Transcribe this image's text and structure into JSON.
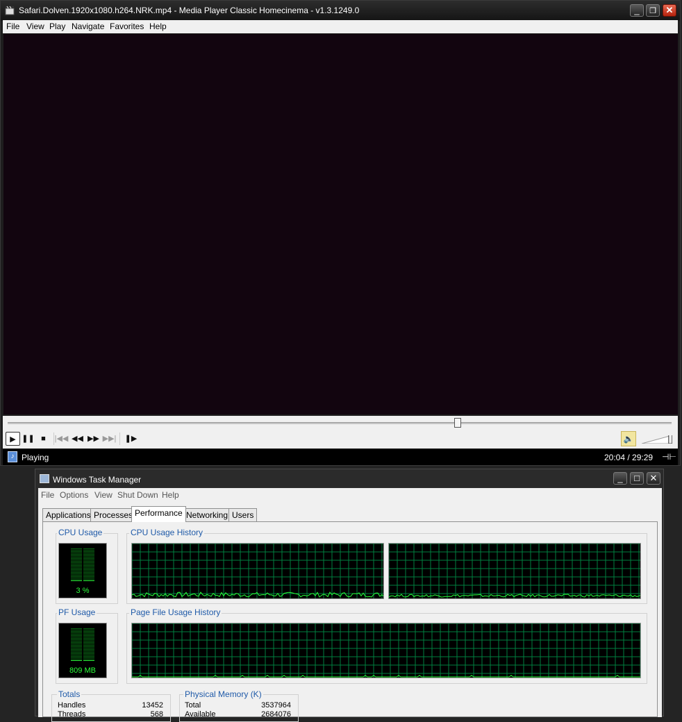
{
  "mpc": {
    "title": "Safari.Dolven.1920x1080.h264.NRK.mp4 - Media Player Classic Homecinema - v1.3.1249.0",
    "menu": [
      "File",
      "View",
      "Play",
      "Navigate",
      "Favorites",
      "Help"
    ],
    "menu_mnemonics": [
      "F",
      "V",
      "P",
      "N",
      "a",
      "H"
    ],
    "seek_position": 0.678,
    "volume_level": 0.95,
    "status": "Playing",
    "time": "20:04 / 29:29",
    "buttons": [
      "play-icon",
      "pause-icon",
      "stop-icon",
      "skip-back-icon",
      "rewind-icon",
      "fast-forward-icon",
      "skip-forward-icon",
      "frame-step-icon"
    ],
    "video_color": "#12050f"
  },
  "taskmanager": {
    "title": "Windows Task Manager",
    "menu": [
      "File",
      "Options",
      "View",
      "Shut Down",
      "Help"
    ],
    "tabs": [
      "Applications",
      "Processes",
      "Performance",
      "Networking",
      "Users"
    ],
    "active_tab": "Performance",
    "cpu_usage_label": "CPU Usage",
    "cpu_usage_value": "3 %",
    "cpu_history_label": "CPU Usage History",
    "pf_usage_label": "PF Usage",
    "pf_usage_value": "809 MB",
    "pf_history_label": "Page File Usage History",
    "totals": {
      "label": "Totals",
      "rows": [
        {
          "name": "Handles",
          "value": "13452"
        },
        {
          "name": "Threads",
          "value": "568"
        }
      ]
    },
    "physical_memory": {
      "label": "Physical Memory (K)",
      "rows": [
        {
          "name": "Total",
          "value": "3537964"
        },
        {
          "name": "Available",
          "value": "2684076"
        }
      ]
    },
    "graph_color": "#2bff3a",
    "grid_color": "#008040"
  }
}
